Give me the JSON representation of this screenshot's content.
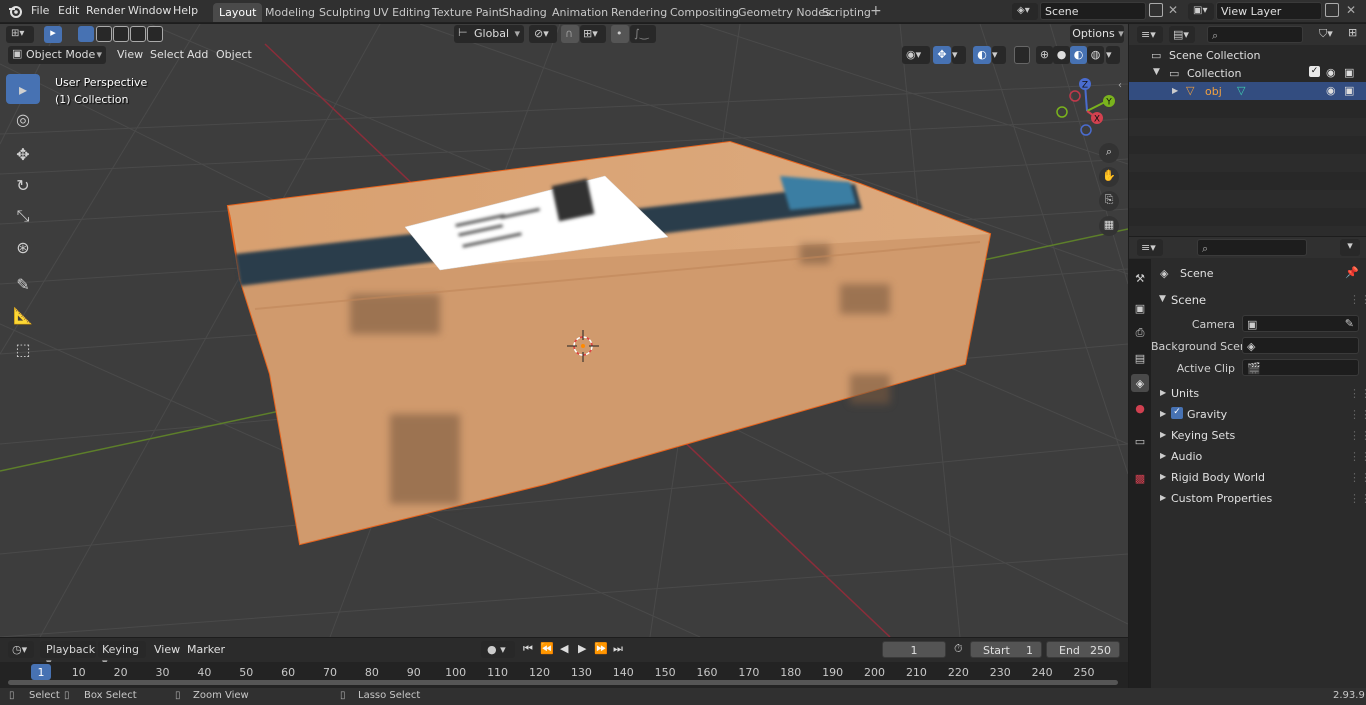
{
  "topbar": {
    "menus": [
      "File",
      "Edit",
      "Render",
      "Window",
      "Help"
    ],
    "workspaces": [
      "Layout",
      "Modeling",
      "Sculpting",
      "UV Editing",
      "Texture Paint",
      "Shading",
      "Animation",
      "Rendering",
      "Compositing",
      "Geometry Nodes",
      "Scripting"
    ],
    "active_workspace": "Layout",
    "scene_name": "Scene",
    "view_layer": "View Layer"
  },
  "viewport_header": {
    "transform_orientation": "Global",
    "options_label": "Options",
    "mode": "Object Mode",
    "menus": [
      "View",
      "Select",
      "Add",
      "Object"
    ]
  },
  "viewport": {
    "perspective_label": "User Perspective",
    "collection_label": "(1) Collection",
    "gizmo_axes": [
      "Z",
      "Y",
      "X"
    ]
  },
  "outliner": {
    "rows": [
      {
        "label": "Scene Collection"
      },
      {
        "label": "Collection"
      },
      {
        "label": "obj"
      }
    ]
  },
  "properties": {
    "header": "Scene",
    "section": "Scene",
    "fields": [
      {
        "label": "Camera",
        "value": ""
      },
      {
        "label": "Background Scene",
        "value": ""
      },
      {
        "label": "Active Clip",
        "value": ""
      }
    ],
    "panels": [
      "Units",
      "Gravity",
      "Keying Sets",
      "Audio",
      "Rigid Body World",
      "Custom Properties"
    ],
    "gravity_checked": true
  },
  "timeline": {
    "menus": [
      "Playback",
      "Keying",
      "View",
      "Marker"
    ],
    "current_frame": "1",
    "start_label": "Start",
    "start": "1",
    "end_label": "End",
    "end": "250",
    "ruler": [
      "1",
      "10",
      "20",
      "30",
      "40",
      "50",
      "60",
      "70",
      "80",
      "90",
      "100",
      "110",
      "120",
      "130",
      "140",
      "150",
      "160",
      "170",
      "180",
      "190",
      "200",
      "210",
      "220",
      "230",
      "240",
      "250"
    ]
  },
  "statusbar": {
    "items": [
      "Select",
      "Box Select",
      "Zoom View",
      "Lasso Select"
    ],
    "version": "2.93.9"
  },
  "colors": {
    "accent": "#4772b3",
    "selection_outline": "#e8631c",
    "x_axis": "#a8343f",
    "y_axis": "#6b9b2a",
    "box": "#d29a6c"
  }
}
